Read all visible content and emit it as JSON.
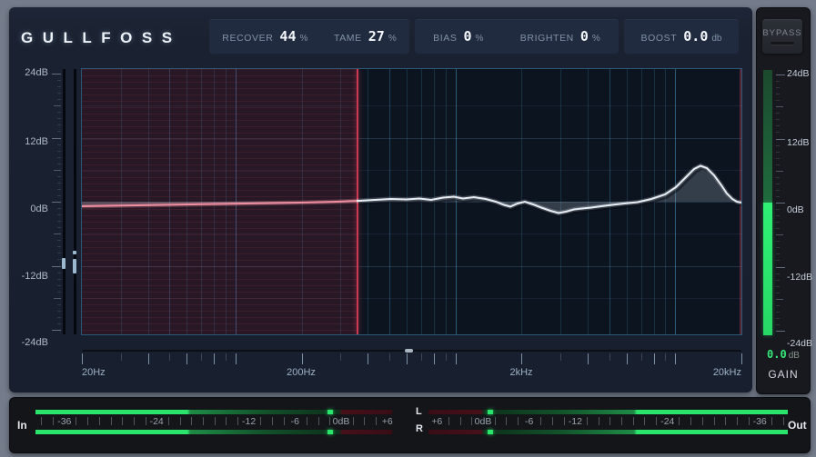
{
  "header": {
    "logo": "GULLFOSS",
    "groups": [
      {
        "params": [
          {
            "label": "RECOVER",
            "value": "44",
            "unit": "%"
          },
          {
            "label": "TAME",
            "value": "27",
            "unit": "%"
          }
        ]
      },
      {
        "params": [
          {
            "label": "BIAS",
            "value": "0",
            "unit": "%"
          },
          {
            "label": "BRIGHTEN",
            "value": "0",
            "unit": "%"
          }
        ]
      },
      {
        "params": [
          {
            "label": "BOOST",
            "value": "0.0",
            "unit": "db"
          }
        ]
      }
    ],
    "bypass": "BYPASS"
  },
  "graph": {
    "db_axis": [
      "24dB",
      "12dB",
      "0dB",
      "-12dB",
      "-24dB"
    ],
    "db_range": [
      24,
      -24
    ],
    "freq_axis": [
      "20Hz",
      "200Hz",
      "2kHz",
      "20kHz"
    ],
    "freq_range_hz": [
      20,
      20000
    ],
    "red_zone_split_hz": 360,
    "focus_handle_hz": 610,
    "curve_peak": {
      "hz": 13000,
      "db": 6.7
    },
    "curve": [
      [
        0,
        151
      ],
      [
        60,
        150
      ],
      [
        120,
        149
      ],
      [
        180,
        148
      ],
      [
        240,
        147
      ],
      [
        280,
        146
      ],
      [
        305,
        145
      ],
      [
        322,
        144
      ],
      [
        340,
        143
      ],
      [
        357,
        143.5
      ],
      [
        371,
        142.5
      ],
      [
        384,
        144
      ],
      [
        397,
        141.5
      ],
      [
        409,
        140.5
      ],
      [
        419,
        142.5
      ],
      [
        431,
        141
      ],
      [
        444,
        143
      ],
      [
        455,
        146
      ],
      [
        464,
        149.5
      ],
      [
        471,
        151.5
      ],
      [
        479,
        148
      ],
      [
        487,
        146
      ],
      [
        496,
        149
      ],
      [
        505,
        152.5
      ],
      [
        515,
        156
      ],
      [
        524,
        158.5
      ],
      [
        532,
        157
      ],
      [
        541,
        154.5
      ],
      [
        550,
        153.5
      ],
      [
        560,
        152.5
      ],
      [
        571,
        151
      ],
      [
        583,
        149.5
      ],
      [
        596,
        148
      ],
      [
        611,
        146.5
      ],
      [
        626,
        143
      ],
      [
        641,
        138
      ],
      [
        653,
        130
      ],
      [
        664,
        119
      ],
      [
        673,
        110
      ],
      [
        680,
        106.5
      ],
      [
        687,
        109
      ],
      [
        695,
        117
      ],
      [
        703,
        128
      ],
      [
        709,
        137
      ],
      [
        715,
        143
      ],
      [
        720,
        146
      ],
      [
        725,
        147
      ]
    ]
  },
  "gain": {
    "scale": [
      "24dB",
      "12dB",
      "0dB",
      "-12dB",
      "-24dB"
    ],
    "value": "0.0",
    "unit": "dB",
    "label": "GAIN",
    "meter_split_db": 0
  },
  "io": {
    "in_label": "In",
    "out_label": "Out",
    "left_label": "L",
    "right_label": "R",
    "in_scale": [
      {
        "db": -36,
        "t": "-36"
      },
      {
        "db": -24,
        "t": "-24"
      },
      {
        "db": -12,
        "t": "-12"
      },
      {
        "db": -6,
        "t": "-6"
      },
      {
        "db": 0,
        "t": "0dB"
      },
      {
        "db": 6,
        "t": "+6"
      }
    ],
    "out_scale": [
      {
        "db": 6,
        "t": "+6"
      },
      {
        "db": 0,
        "t": "0dB"
      },
      {
        "db": -6,
        "t": "-6"
      },
      {
        "db": -12,
        "t": "-12"
      },
      {
        "db": -24,
        "t": "-24"
      },
      {
        "db": -36,
        "t": "-36"
      }
    ],
    "in_levels": {
      "bright_db": -20,
      "peak_db": -1.4
    },
    "out_levels": {
      "bright_db": -20,
      "peak_db": -0.95
    }
  },
  "colors": {
    "meter_bright_green": "#2ae46b",
    "meter_mid_green": "#1e8c46",
    "meter_dim_green": "#0d2f1b",
    "meter_dim_red": "#471019",
    "meter_dark_red": "#3a0d14",
    "curve_left_pink": "#ef8fa0",
    "curve_right_white": "#e8eff4",
    "red_line": "#cc3950",
    "grid_blue": "#4f9fd0",
    "gain_green": "#35e878"
  }
}
